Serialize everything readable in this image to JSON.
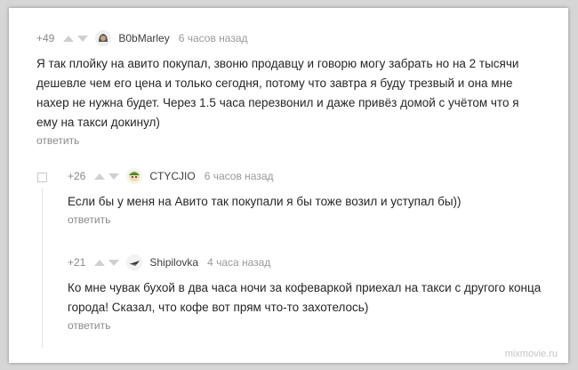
{
  "comments": [
    {
      "score": "+49",
      "author": "B0bMarley",
      "time": "6 часов назад",
      "text": "Я так плойку на авито покупал, звоню продавцу и говорю могу забрать но на 2 тысячи дешевле чем его цена и только сегодня, потому что завтра я буду трезвый и она мне нахер не нужна будет. Через 1.5 часа перезвонил и даже привёз домой с учётом что я ему на такси докинул)",
      "reply": "ответить",
      "avatar_icon": "bob-marley-avatar-icon"
    },
    {
      "score": "+26",
      "author": "CTYCJIO",
      "time": "6 часов назад",
      "text": "Если бы у меня на Авито так покупали я бы тоже возил и уступал бы))",
      "reply": "ответить",
      "avatar_icon": "cartoon-avatar-icon"
    },
    {
      "score": "+21",
      "author": "Shipilovka",
      "time": "4 часа назад",
      "text": "Ко мне чувак бухой в два часа ночи за кофеваркой приехал на такси с другого конца города! Сказал, что кофе вот прям что-то захотелось)",
      "reply": "ответить",
      "avatar_icon": "spaceship-avatar-icon"
    }
  ],
  "watermark": "mixmovie.ru",
  "colors": {
    "background": "#ffffff",
    "meta": "#8a8a8a",
    "text": "#262626",
    "arrows": "#cfcfcf"
  }
}
